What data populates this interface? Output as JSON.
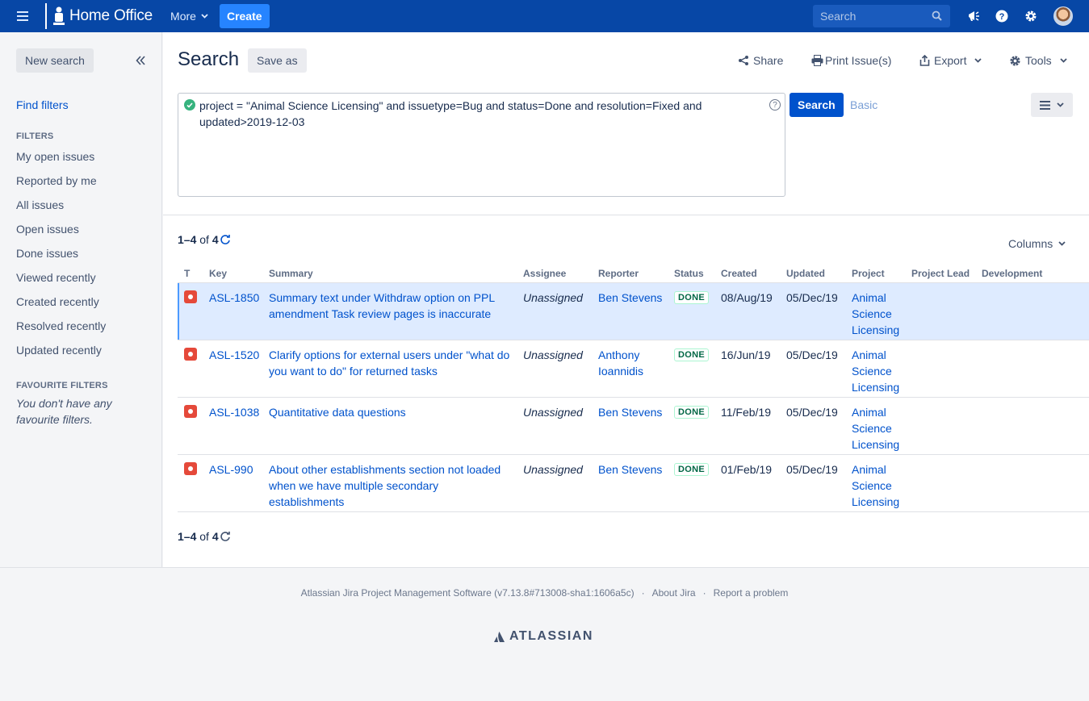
{
  "header": {
    "logo_text": "Home Office",
    "more_label": "More",
    "create_label": "Create",
    "search_placeholder": "Search"
  },
  "sidebar": {
    "new_search_label": "New search",
    "find_filters_label": "Find filters",
    "filters_heading": "FILTERS",
    "filters": [
      "My open issues",
      "Reported by me",
      "All issues",
      "Open issues",
      "Done issues",
      "Viewed recently",
      "Created recently",
      "Resolved recently",
      "Updated recently"
    ],
    "favourites_heading": "FAVOURITE FILTERS",
    "no_favourites_text": "You don't have any favourite filters."
  },
  "search": {
    "title": "Search",
    "save_as_label": "Save as",
    "share_label": "Share",
    "print_label": "Print Issue(s)",
    "export_label": "Export",
    "tools_label": "Tools",
    "jql": "project = \"Animal Science Licensing\" and issuetype=Bug  and status=Done and resolution=Fixed and updated>2019-12-03",
    "search_button_label": "Search",
    "basic_label": "Basic",
    "columns_label": "Columns"
  },
  "results": {
    "range": "1–4",
    "of_label": "of",
    "total": "4",
    "columns": [
      "T",
      "Key",
      "Summary",
      "Assignee",
      "Reporter",
      "Status",
      "Created",
      "Updated",
      "Project",
      "Project Lead",
      "Development"
    ],
    "rows": [
      {
        "key": "ASL-1850",
        "summary": "Summary text under Withdraw option on PPL amendment Task review pages is inaccurate",
        "assignee": "Unassigned",
        "reporter": "Ben Stevens",
        "status": "DONE",
        "created": "08/Aug/19",
        "updated": "05/Dec/19",
        "project": "Animal Science Licensing",
        "project_lead": "",
        "development": ""
      },
      {
        "key": "ASL-1520",
        "summary": "Clarify options for external users under \"what do you want to do\" for returned tasks",
        "assignee": "Unassigned",
        "reporter": "Anthony Ioannidis",
        "status": "DONE",
        "created": "16/Jun/19",
        "updated": "05/Dec/19",
        "project": "Animal Science Licensing",
        "project_lead": "",
        "development": ""
      },
      {
        "key": "ASL-1038",
        "summary": "Quantitative data questions",
        "assignee": "Unassigned",
        "reporter": "Ben Stevens",
        "status": "DONE",
        "created": "11/Feb/19",
        "updated": "05/Dec/19",
        "project": "Animal Science Licensing",
        "project_lead": "",
        "development": ""
      },
      {
        "key": "ASL-990",
        "summary": "About other establishments section not loaded when we have multiple secondary establishments",
        "assignee": "Unassigned",
        "reporter": "Ben Stevens",
        "status": "DONE",
        "created": "01/Feb/19",
        "updated": "05/Dec/19",
        "project": "Animal Science Licensing",
        "project_lead": "",
        "development": ""
      }
    ]
  },
  "footer": {
    "software_text": "Atlassian Jira Project Management Software (v7.13.8#713008-sha1:1606a5c)",
    "about_label": "About Jira",
    "report_label": "Report a problem",
    "atlassian_label": "ATLASSIAN"
  }
}
